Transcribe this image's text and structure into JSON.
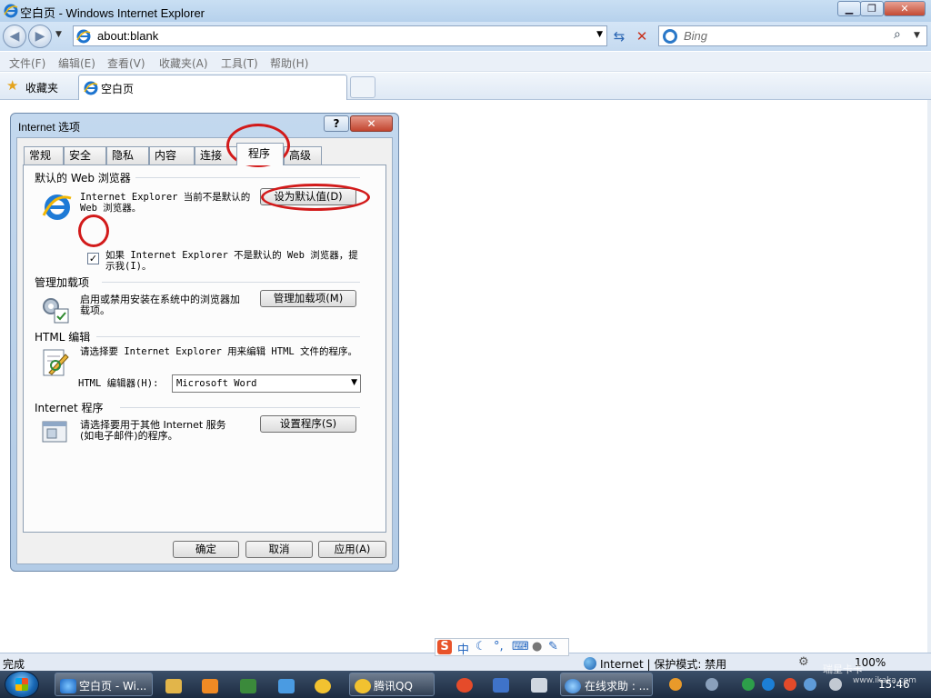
{
  "window": {
    "title": "空白页 - Windows Internet Explorer",
    "min_glyph": "▁",
    "max_glyph": "❐",
    "close_glyph": "✕"
  },
  "address_bar": {
    "url": "about:blank",
    "search_placeholder": "Bing"
  },
  "menu": {
    "items": [
      "文件(F)",
      "编辑(E)",
      "查看(V)",
      "收藏夹(A)",
      "工具(T)",
      "帮助(H)"
    ]
  },
  "favorites_bar": {
    "favorites_label": "收藏夹",
    "tab_title": "空白页"
  },
  "dialog": {
    "title": "Internet 选项",
    "help_glyph": "?",
    "close_glyph": "✕",
    "tabs": [
      "常规",
      "安全",
      "隐私",
      "内容",
      "连接",
      "程序",
      "高级"
    ],
    "active_tab": "程序",
    "sections": {
      "default_browser": {
        "title": "默认的 Web 浏览器",
        "text_line1": "Internet Explorer 当前不是默认的",
        "text_line2": "Web 浏览器。",
        "button": "设为默认值(D)",
        "checkbox_checked": true,
        "checkbox_mark": "✓",
        "checkbox_line1": "如果 Internet Explorer 不是默认的 Web 浏览器，提",
        "checkbox_line2": "示我(I)。"
      },
      "addons": {
        "title": "管理加载项",
        "text_line1": "启用或禁用安装在系统中的浏览器加",
        "text_line2": "载项。",
        "button": "管理加载项(M)"
      },
      "html_editing": {
        "title": "HTML 编辑",
        "text": "请选择要 Internet Explorer 用来编辑 HTML 文件的程序。",
        "editor_label": "HTML 编辑器(H):",
        "editor_value": "Microsoft Word"
      },
      "internet_programs": {
        "title": "Internet 程序",
        "text_line1": "请选择要用于其他 Internet 服务",
        "text_line2": "(如电子邮件)的程序。",
        "button": "设置程序(S)"
      }
    },
    "buttons": {
      "ok": "确定",
      "cancel": "取消",
      "apply": "应用(A)"
    }
  },
  "status_bar": {
    "text": "完成",
    "zone": "Internet | 保护模式: 禁用",
    "zoom": "100%"
  },
  "ime_bar": {
    "logo": "S",
    "mode": "中"
  },
  "taskbar": {
    "tasks": [
      {
        "label": "空白页 - Wi..."
      },
      {
        "label": "腾讯QQ"
      },
      {
        "label": "在线求助 : ..."
      }
    ],
    "clock": "15:46"
  },
  "watermark": {
    "brand": "瑞星卡卡",
    "url": "www.ikaka.com"
  },
  "colors": {
    "annotation": "#d21a1a",
    "chrome": "#c3d8ee",
    "taskbar": "#1c2b40"
  }
}
